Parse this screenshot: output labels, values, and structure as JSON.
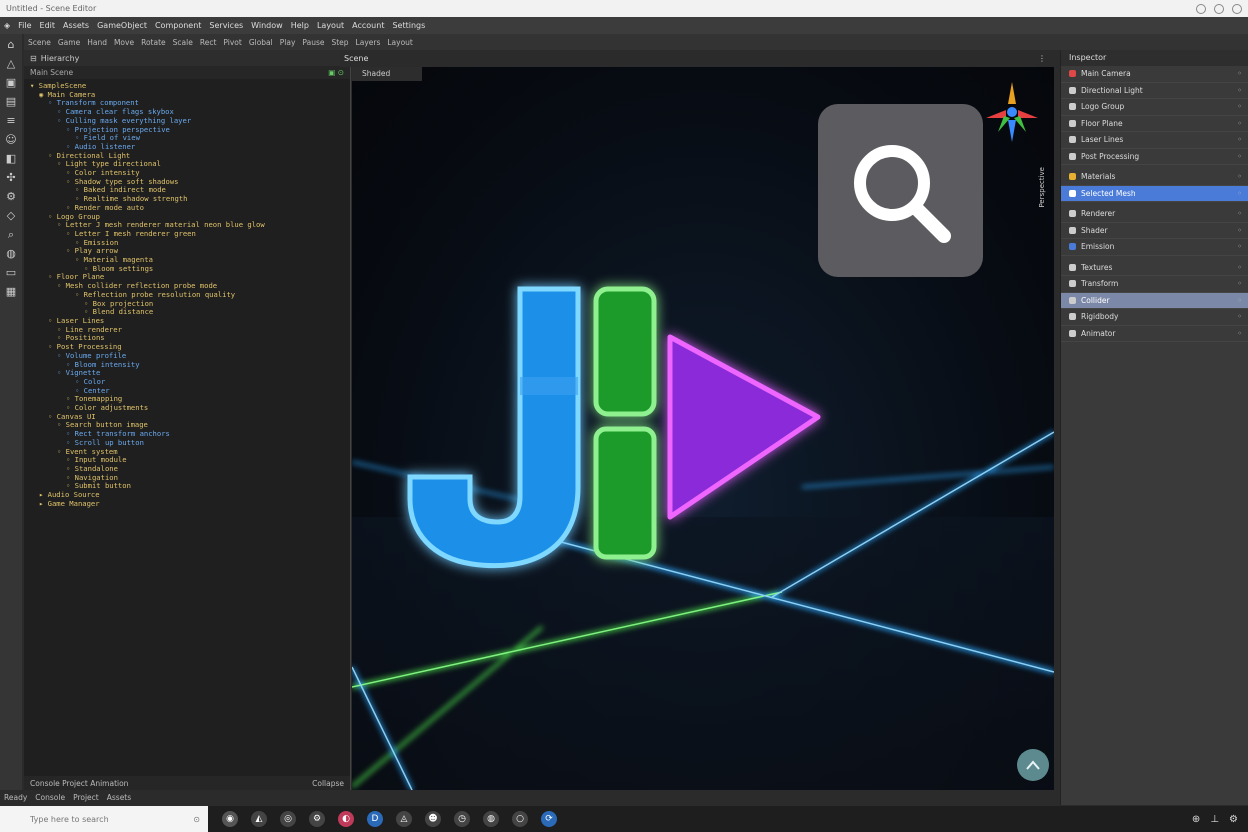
{
  "window": {
    "title": "Untitled - Scene Editor",
    "buttons": [
      "minimize",
      "maximize",
      "close"
    ]
  },
  "menubar": {
    "items": [
      "File",
      "Edit",
      "Assets",
      "GameObject",
      "Component",
      "Services",
      "Window",
      "Help",
      "Layout",
      "Account",
      "Settings"
    ]
  },
  "toolbar": {
    "items": [
      "Scene",
      "Game",
      "Hand",
      "Move",
      "Rotate",
      "Scale",
      "Rect",
      "Pivot",
      "Global",
      "Play",
      "Pause",
      "Step",
      "Layers",
      "Layout"
    ]
  },
  "left_strip_icons": [
    "home-icon",
    "triangle-icon",
    "image-icon",
    "folder-icon",
    "layers-icon",
    "user-icon",
    "bookmark-icon",
    "puzzle-icon",
    "settings-icon",
    "cube-icon",
    "search-icon",
    "globe-icon",
    "terminal-icon",
    "package-icon"
  ],
  "editor": {
    "tab_title": "Hierarchy",
    "subheader": "Main Scene",
    "lines": [
      {
        "indent": 0,
        "text": "▾ SampleScene",
        "color": "#e0c36a"
      },
      {
        "indent": 1,
        "text": "◉ Main Camera",
        "color": "#e0c36a"
      },
      {
        "indent": 2,
        "text": "◦ Transform component",
        "color": "#6aaaf0"
      },
      {
        "indent": 3,
        "text": "◦ Camera clear flags skybox",
        "color": "#6aaaf0"
      },
      {
        "indent": 3,
        "text": "◦ Culling mask everything layer",
        "color": "#6aaaf0"
      },
      {
        "indent": 4,
        "text": "◦ Projection perspective",
        "color": "#6aaaf0"
      },
      {
        "indent": 5,
        "text": "◦ Field of view",
        "color": "#6aaaf0"
      },
      {
        "indent": 4,
        "text": "◦ Audio listener",
        "color": "#6aaaf0"
      },
      {
        "indent": 2,
        "text": "◦ Directional Light",
        "color": "#e0c36a"
      },
      {
        "indent": 3,
        "text": "◦ Light type directional",
        "color": "#e0c36a"
      },
      {
        "indent": 4,
        "text": "◦ Color intensity",
        "color": "#e0c36a"
      },
      {
        "indent": 4,
        "text": "◦ Shadow type soft shadows",
        "color": "#e0c36a"
      },
      {
        "indent": 5,
        "text": "◦ Baked indirect mode",
        "color": "#e0c36a"
      },
      {
        "indent": 5,
        "text": "◦ Realtime shadow strength",
        "color": "#e0c36a"
      },
      {
        "indent": 4,
        "text": "◦ Render mode auto",
        "color": "#e0c36a"
      },
      {
        "indent": 2,
        "text": "◦ Logo Group",
        "color": "#e0c36a"
      },
      {
        "indent": 3,
        "text": "◦ Letter J mesh renderer material neon blue glow",
        "color": "#e0c36a"
      },
      {
        "indent": 4,
        "text": "◦ Letter I mesh renderer green",
        "color": "#e0c36a"
      },
      {
        "indent": 5,
        "text": "◦ Emission",
        "color": "#e0c36a"
      },
      {
        "indent": 4,
        "text": "◦ Play arrow",
        "color": "#e0c36a"
      },
      {
        "indent": 5,
        "text": "◦ Material magenta",
        "color": "#e0c36a"
      },
      {
        "indent": 6,
        "text": "◦ Bloom settings",
        "color": "#e0c36a"
      },
      {
        "indent": 2,
        "text": "◦ Floor Plane",
        "color": "#e0c36a"
      },
      {
        "indent": 3,
        "text": "◦ Mesh collider reflection probe mode",
        "color": "#e0c36a"
      },
      {
        "indent": 5,
        "text": "◦ Reflection probe resolution quality",
        "color": "#e0c36a"
      },
      {
        "indent": 6,
        "text": "◦ Box projection",
        "color": "#e0c36a"
      },
      {
        "indent": 6,
        "text": "◦ Blend distance",
        "color": "#e0c36a"
      },
      {
        "indent": 2,
        "text": "◦ Laser Lines",
        "color": "#e0c36a"
      },
      {
        "indent": 3,
        "text": "◦ Line renderer",
        "color": "#e0c36a"
      },
      {
        "indent": 3,
        "text": "◦ Positions",
        "color": "#e0c36a"
      },
      {
        "indent": 2,
        "text": "◦ Post Processing",
        "color": "#e0c36a"
      },
      {
        "indent": 3,
        "text": "◦ Volume profile",
        "color": "#6aaaf0"
      },
      {
        "indent": 4,
        "text": "◦ Bloom intensity",
        "color": "#6aaaf0"
      },
      {
        "indent": 3,
        "text": "◦ Vignette",
        "color": "#6aaaf0"
      },
      {
        "indent": 5,
        "text": "◦ Color",
        "color": "#6aaaf0"
      },
      {
        "indent": 5,
        "text": "◦ Center",
        "color": "#6aaaf0"
      },
      {
        "indent": 4,
        "text": "◦ Tonemapping",
        "color": "#e0c36a"
      },
      {
        "indent": 4,
        "text": "◦ Color adjustments",
        "color": "#e0c36a"
      },
      {
        "indent": 2,
        "text": "◦ Canvas UI",
        "color": "#e0c36a"
      },
      {
        "indent": 3,
        "text": "◦ Search button image",
        "color": "#e0c36a"
      },
      {
        "indent": 4,
        "text": "◦ Rect transform anchors",
        "color": "#6aaaf0"
      },
      {
        "indent": 4,
        "text": "◦ Scroll up button",
        "color": "#6aaaf0"
      },
      {
        "indent": 3,
        "text": "◦ Event system",
        "color": "#e0c36a"
      },
      {
        "indent": 4,
        "text": "◦ Input module",
        "color": "#e0c36a"
      },
      {
        "indent": 4,
        "text": "◦ Standalone",
        "color": "#e0c36a"
      },
      {
        "indent": 4,
        "text": "◦ Navigation",
        "color": "#e0c36a"
      },
      {
        "indent": 4,
        "text": "◦ Submit button",
        "color": "#e0c36a"
      },
      {
        "indent": 1,
        "text": "▸ Audio Source",
        "color": "#e0c36a"
      },
      {
        "indent": 1,
        "text": "▸ Game Manager",
        "color": "#e0c36a"
      }
    ],
    "footer_left": "Console  Project  Animation",
    "footer_right": "Collapse"
  },
  "viewport": {
    "header_title": "Scene",
    "tab_label": "Shaded",
    "side_label": "Perspective",
    "logo_letters": [
      "J",
      "I"
    ],
    "scroll_up_label": "^"
  },
  "inspector": {
    "header": "Inspector",
    "items": [
      {
        "label": "Main Camera",
        "color": "#e04848",
        "state": "normal"
      },
      {
        "label": "Directional Light",
        "color": "#cccccc",
        "state": "normal"
      },
      {
        "label": "Logo Group",
        "color": "#cccccc",
        "state": "normal"
      },
      {
        "label": "Floor Plane",
        "color": "#cccccc",
        "state": "normal"
      },
      {
        "label": "Laser Lines",
        "color": "#cccccc",
        "state": "normal"
      },
      {
        "label": "Post Processing",
        "color": "#cccccc",
        "state": "normal"
      },
      {
        "label": "Materials",
        "color": "#e8b030",
        "state": "gap"
      },
      {
        "label": "Selected Mesh",
        "color": "#ffffff",
        "state": "sel"
      },
      {
        "label": "Renderer",
        "color": "#cccccc",
        "state": "gap"
      },
      {
        "label": "Shader",
        "color": "#cccccc",
        "state": "normal"
      },
      {
        "label": "Emission",
        "color": "#4a7bd8",
        "state": "normal"
      },
      {
        "label": "Textures",
        "color": "#cccccc",
        "state": "gap"
      },
      {
        "label": "Transform",
        "color": "#cccccc",
        "state": "normal"
      },
      {
        "label": "Collider",
        "color": "#cccccc",
        "state": "sel2"
      },
      {
        "label": "Rigidbody",
        "color": "#cccccc",
        "state": "normal"
      },
      {
        "label": "Animator",
        "color": "#cccccc",
        "state": "normal"
      }
    ]
  },
  "statusbar": {
    "items": [
      "Ready",
      "Console",
      "Project",
      "Assets"
    ]
  },
  "taskbar": {
    "search_placeholder": "Type here to search",
    "apps": [
      {
        "icon": "files-icon",
        "color": "#555555"
      },
      {
        "icon": "edge-icon",
        "color": "#444444"
      },
      {
        "icon": "chrome-icon",
        "color": "#444444"
      },
      {
        "icon": "settings-icon",
        "color": "#444444"
      },
      {
        "icon": "media-icon",
        "color": "#c03a5a"
      },
      {
        "icon": "d-icon",
        "color": "#2a6ab8"
      },
      {
        "icon": "location-icon",
        "color": "#444444"
      },
      {
        "icon": "cat-icon",
        "color": "#444444"
      },
      {
        "icon": "clock-icon",
        "color": "#444444"
      },
      {
        "icon": "globe-icon",
        "color": "#444444"
      },
      {
        "icon": "circle-icon",
        "color": "#444444"
      },
      {
        "icon": "update-icon",
        "color": "#2a6ab8"
      }
    ],
    "tray": [
      "network-icon",
      "pin-icon",
      "settings-icon"
    ]
  }
}
